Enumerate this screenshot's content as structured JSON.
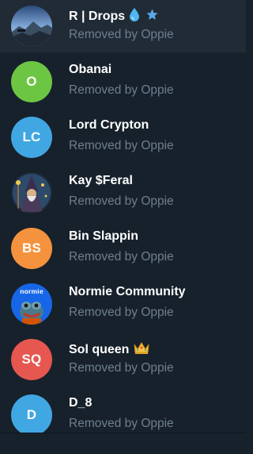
{
  "members": [
    {
      "name": "R | Drops",
      "subtitle": "Removed by Oppie",
      "avatar_type": "photo",
      "avatar_desc": "mountain-landscape-icon",
      "badges": [
        "droplet-icon",
        "star-icon"
      ],
      "highlight": true
    },
    {
      "name": "Obanai",
      "subtitle": "Removed by Oppie",
      "avatar_type": "initials",
      "initials": "O",
      "color": "#6cc644"
    },
    {
      "name": "Lord Crypton",
      "subtitle": "Removed by Oppie",
      "avatar_type": "initials",
      "initials": "LC",
      "color": "#40a7e3"
    },
    {
      "name": "Kay $Feral",
      "subtitle": "Removed by Oppie",
      "avatar_type": "photo",
      "avatar_desc": "wizard-illustration-icon"
    },
    {
      "name": "Bin Slappin",
      "subtitle": "Removed by Oppie",
      "avatar_type": "initials",
      "initials": "BS",
      "color": "#f5923e"
    },
    {
      "name": "Normie Community",
      "subtitle": "Removed by Oppie",
      "avatar_type": "photo",
      "avatar_desc": "normie-frog-icon",
      "avatar_text": "normie"
    },
    {
      "name": "Sol queen",
      "subtitle": "Removed by Oppie",
      "avatar_type": "initials",
      "initials": "SQ",
      "color": "#e5574f",
      "badges": [
        "crown-icon"
      ]
    },
    {
      "name": "D_8",
      "subtitle": "Removed by Oppie",
      "avatar_type": "initials",
      "initials": "D",
      "color": "#40a7e3"
    }
  ]
}
